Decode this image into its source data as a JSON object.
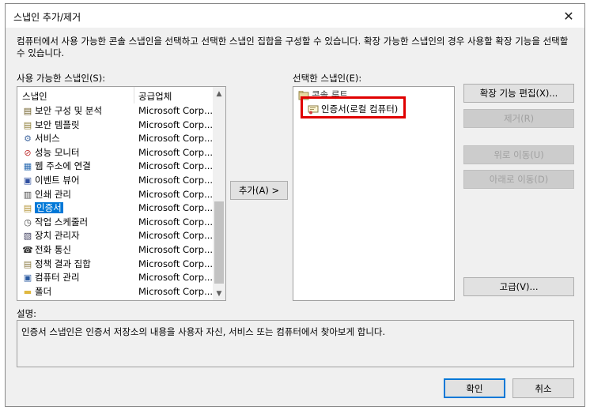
{
  "window": {
    "title": "스냅인 추가/제거",
    "close_glyph": "✕"
  },
  "intro_text": "컴퓨터에서 사용 가능한 콘솔 스냅인을 선택하고 선택한 스냅인 집합을 구성할 수 있습니다. 확장 가능한 스냅인의 경우 사용할 확장 기능을 선택할 수 있습니다.",
  "available": {
    "label": "사용 가능한 스냅인(S):",
    "col_snapin": "스냅인",
    "col_vendor": "공급업체",
    "scroll_up": "▲",
    "scroll_down": "▼",
    "items": [
      {
        "name": "보안 구성 및 분석",
        "vendor": "Microsoft Corp...",
        "icon": "security-analysis-icon"
      },
      {
        "name": "보안 템플릿",
        "vendor": "Microsoft Corp...",
        "icon": "security-template-icon"
      },
      {
        "name": "서비스",
        "vendor": "Microsoft Corp...",
        "icon": "services-gear-icon"
      },
      {
        "name": "성능 모니터",
        "vendor": "Microsoft Corp...",
        "icon": "performance-monitor-icon"
      },
      {
        "name": "웹 주소에 연결",
        "vendor": "Microsoft Corp...",
        "icon": "web-link-icon"
      },
      {
        "name": "이벤트 뷰어",
        "vendor": "Microsoft Corp...",
        "icon": "event-viewer-icon"
      },
      {
        "name": "인쇄 관리",
        "vendor": "Microsoft Corp...",
        "icon": "print-management-icon"
      },
      {
        "name": "인증서",
        "vendor": "Microsoft Corp...",
        "icon": "certificate-icon",
        "selected": true
      },
      {
        "name": "작업 스케줄러",
        "vendor": "Microsoft Corp...",
        "icon": "task-scheduler-icon"
      },
      {
        "name": "장치 관리자",
        "vendor": "Microsoft Corp...",
        "icon": "device-manager-icon"
      },
      {
        "name": "전화 통신",
        "vendor": "Microsoft Corp...",
        "icon": "telephony-icon"
      },
      {
        "name": "정책 결과 집합",
        "vendor": "Microsoft Corp...",
        "icon": "policy-results-icon"
      },
      {
        "name": "컴퓨터 관리",
        "vendor": "Microsoft Corp...",
        "icon": "computer-management-icon"
      },
      {
        "name": "폴더",
        "vendor": "Microsoft Corp...",
        "icon": "folder-icon"
      }
    ]
  },
  "add_button": "추가(A) >",
  "selected": {
    "label": "선택한 스냅인(E):",
    "root": "콘솔 루트",
    "child": "인증서(로컬 컴퓨터)"
  },
  "right_buttons": {
    "edit_extensions": "확장 기능 편집(X)...",
    "remove": "제거(R)",
    "move_up": "위로 이동(U)",
    "move_down": "아래로 이동(D)",
    "advanced": "고급(V)..."
  },
  "description": {
    "label": "설명:",
    "text": "인증서 스냅인은 인증서 저장소의 내용을 사용자 자신, 서비스 또는 컴퓨터에서 찾아보게 합니다."
  },
  "footer": {
    "ok": "확인",
    "cancel": "취소"
  },
  "colors": {
    "selection": "#0078d7",
    "highlight_box": "#e00000",
    "dialog_bg": "#f0f0f0"
  }
}
